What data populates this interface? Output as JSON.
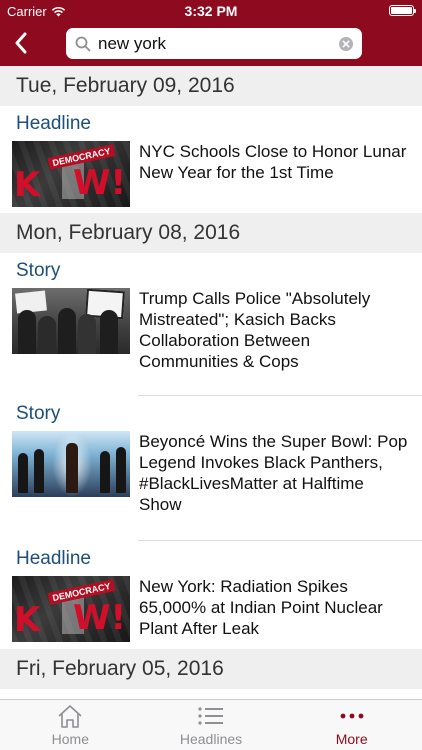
{
  "status_bar": {
    "carrier": "Carrier",
    "time": "3:32 PM",
    "battery_level": 1.0
  },
  "nav": {
    "back_icon": "chevron-left-icon",
    "search_value": "new york",
    "search_icon": "search-icon",
    "clear_icon": "clear-icon"
  },
  "sections": [
    {
      "date": "Tue, February 09, 2016",
      "items": [
        {
          "type": "Headline",
          "title": "NYC Schools Close to Honor Lunar New Year for the 1st Time",
          "thumb": "democracy-now-logo"
        }
      ]
    },
    {
      "date": "Mon, February 08, 2016",
      "items": [
        {
          "type": "Story",
          "title": "Trump Calls Police \"Absolutely Mistreated\"; Kasich Backs Collaboration Between Communities & Cops",
          "thumb": "protest-photo"
        },
        {
          "type": "Story",
          "title": "Beyoncé Wins the Super Bowl: Pop Legend Invokes Black Panthers, #BlackLivesMatter at Halftime Show",
          "thumb": "halftime-show-photo"
        },
        {
          "type": "Headline",
          "title": "New York: Radiation Spikes 65,000% at Indian Point Nuclear Plant After Leak",
          "thumb": "democracy-now-logo"
        }
      ]
    },
    {
      "date": "Fri, February 05, 2016",
      "items": []
    }
  ],
  "tabbar": {
    "tabs": [
      {
        "label": "Home",
        "icon": "home-icon",
        "active": false
      },
      {
        "label": "Headlines",
        "icon": "list-icon",
        "active": false
      },
      {
        "label": "More",
        "icon": "more-icon",
        "active": true
      }
    ]
  },
  "colors": {
    "brand": "#8e0a1e",
    "type_label": "#1d4f7a",
    "section_bg": "#efefef",
    "tab_inactive": "#8e8e93"
  }
}
